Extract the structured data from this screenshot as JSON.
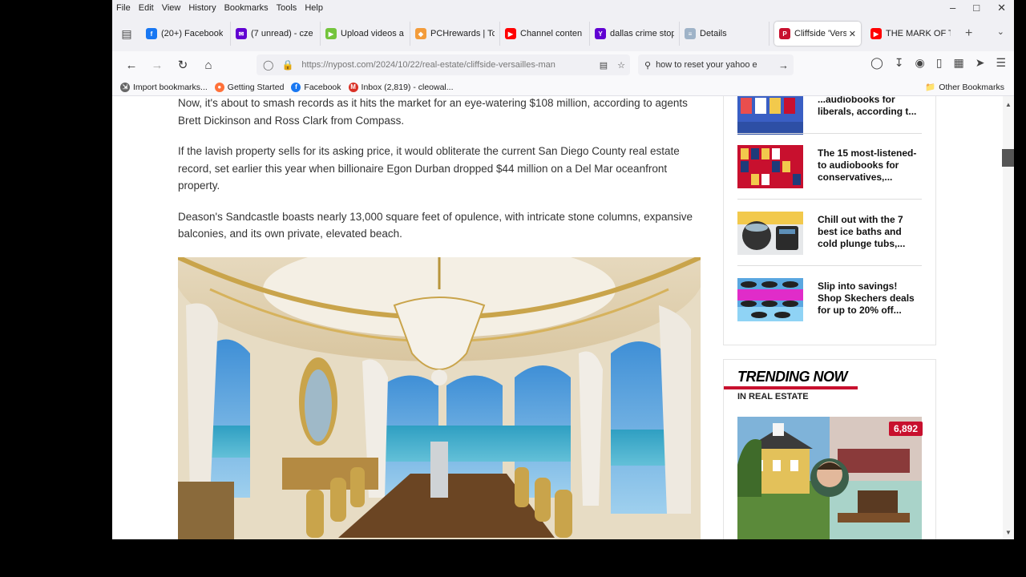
{
  "menu": [
    "File",
    "Edit",
    "View",
    "History",
    "Bookmarks",
    "Tools",
    "Help"
  ],
  "tabs": [
    {
      "label": "(20+) Facebook",
      "icon": "facebook-icon",
      "color": "#1877f2",
      "glyph": "f"
    },
    {
      "label": "(7 unread) - cze",
      "icon": "yahoo-mail-icon",
      "color": "#6001d2",
      "glyph": "✉"
    },
    {
      "label": "Upload videos a",
      "icon": "rumble-icon",
      "color": "#74c43c",
      "glyph": "▶"
    },
    {
      "label": "PCHrewards | Tc",
      "icon": "pch-icon",
      "color": "#f39c3b",
      "glyph": "◆"
    },
    {
      "label": "Channel conten",
      "icon": "youtube-icon",
      "color": "#ff0000",
      "glyph": "▶"
    },
    {
      "label": "dallas crime stop",
      "icon": "yahoo-icon",
      "color": "#6001d2",
      "glyph": "Y"
    },
    {
      "label": "Details",
      "icon": "document-icon",
      "color": "#9fb3c8",
      "glyph": "≡"
    }
  ],
  "active_tab": {
    "label": "Cliffside 'Vers",
    "icon": "nypost-icon",
    "color": "#c8102e",
    "glyph": "P"
  },
  "after_tab": {
    "label": "THE MARK OF T",
    "icon": "youtube-icon",
    "color": "#ff0000",
    "glyph": "▶"
  },
  "url": "https://nypost.com/2024/10/22/real-estate/cliffside-versailles-man",
  "search": "how to reset your yahoo e",
  "bookmarks": [
    {
      "label": "Import bookmarks...",
      "icon": "import-icon",
      "color": "#666",
      "glyph": "⇲"
    },
    {
      "label": "Getting Started",
      "icon": "firefox-icon",
      "color": "#ff7139",
      "glyph": "●"
    },
    {
      "label": "Facebook",
      "icon": "facebook-icon",
      "color": "#1877f2",
      "glyph": "f"
    },
    {
      "label": "Inbox (2,819) - cleowal...",
      "icon": "gmail-icon",
      "color": "#d93025",
      "glyph": "M"
    }
  ],
  "other_bookmarks": "Other Bookmarks",
  "article": {
    "p1": "Now, it's about to smash records as it hits the market for an eye-watering $108 million, according to agents Brett Dickinson and Ross Clark from Compass.",
    "p2": "If the lavish property sells for its asking price, it would obliterate the current San Diego County real estate record, set earlier this year when billionaire Egon Durban dropped $44 million on a Del Mar oceanfront property.",
    "p3": "Deason's Sandcastle boasts nearly 13,000 square feet of opulence, with intricate stone columns, expansive balconies, and its own private, elevated beach."
  },
  "sidebar": [
    {
      "title": "...audiobooks for liberals, according t...",
      "thumb": "audiobooks-liberals"
    },
    {
      "title": "The 15 most-listened-to audiobooks for conservatives,...",
      "thumb": "audiobooks-conservatives"
    },
    {
      "title": "Chill out with the 7 best ice baths and cold plunge tubs,...",
      "thumb": "ice-baths"
    },
    {
      "title": "Slip into savings! Shop Skechers deals for up to 20% off...",
      "thumb": "skechers"
    }
  ],
  "trending": {
    "title": "TRENDING NOW",
    "subtitle": "IN REAL ESTATE",
    "badge": "6,892"
  },
  "colors": {
    "brand_red": "#c8102e",
    "chrome": "#f0f0f4"
  }
}
